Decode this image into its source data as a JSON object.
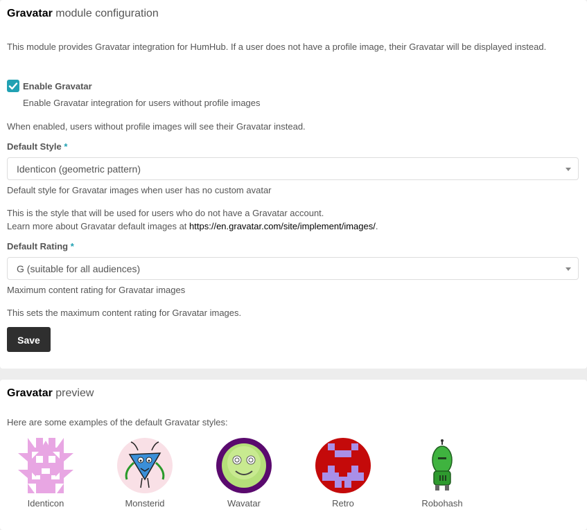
{
  "config": {
    "heading_strong": "Gravatar",
    "heading_rest": "module configuration",
    "intro": "This module provides Gravatar integration for HumHub. If a user does not have a profile image, their Gravatar will be displayed instead.",
    "enable": {
      "label": "Enable Gravatar",
      "checked": true,
      "hint": "Enable Gravatar integration for users without profile images"
    },
    "enable_note": "When enabled, users without profile images will see their Gravatar instead.",
    "default_style": {
      "label": "Default Style",
      "required_mark": "*",
      "value": "Identicon (geometric pattern)",
      "hint": "Default style for Gravatar images when user has no custom avatar",
      "note_line1": "This is the style that will be used for users who do not have a Gravatar account.",
      "note_line2_prefix": "Learn more about Gravatar default images at ",
      "note_link": "https://en.gravatar.com/site/implement/images/",
      "note_line2_suffix": "."
    },
    "default_rating": {
      "label": "Default Rating",
      "required_mark": "*",
      "value": "G (suitable for all audiences)",
      "hint": "Maximum content rating for Gravatar images",
      "note": "This sets the maximum content rating for Gravatar images."
    },
    "save_label": "Save"
  },
  "preview": {
    "heading_strong": "Gravatar",
    "heading_rest": "preview",
    "intro": "Here are some examples of the default Gravatar styles:",
    "items": [
      {
        "label": "Identicon",
        "icon": "identicon-icon"
      },
      {
        "label": "Monsterid",
        "icon": "monsterid-icon"
      },
      {
        "label": "Wavatar",
        "icon": "wavatar-icon"
      },
      {
        "label": "Retro",
        "icon": "retro-icon"
      },
      {
        "label": "Robohash",
        "icon": "robohash-icon"
      }
    ]
  },
  "colors": {
    "accent": "#21a1b3",
    "button": "#2f2f2f"
  }
}
